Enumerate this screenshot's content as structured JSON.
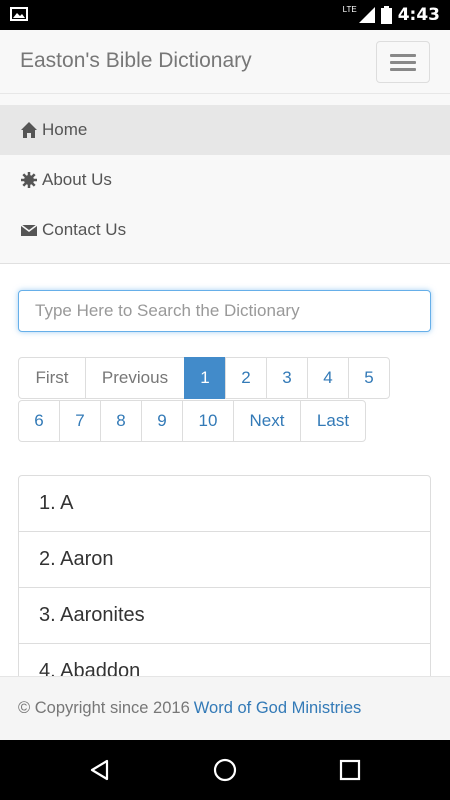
{
  "status_bar": {
    "network": "LTE",
    "time": "4:43"
  },
  "navbar": {
    "brand": "Easton's Bible Dictionary"
  },
  "menu": {
    "items": [
      {
        "label": "Home",
        "icon": "home-icon"
      },
      {
        "label": "About Us",
        "icon": "gear-icon"
      },
      {
        "label": "Contact Us",
        "icon": "envelope-icon"
      }
    ]
  },
  "search": {
    "placeholder": "Type Here to Search the Dictionary",
    "value": ""
  },
  "pagination": {
    "row1": [
      "First",
      "Previous",
      "1",
      "2",
      "3",
      "4",
      "5"
    ],
    "row2": [
      "6",
      "7",
      "8",
      "9",
      "10",
      "Next",
      "Last"
    ],
    "active": "1"
  },
  "entries": [
    "1. A",
    "2. Aaron",
    "3. Aaronites",
    "4. Abaddon"
  ],
  "footer": {
    "copyright": "© Copyright since 2016",
    "link": "Word of God Ministries"
  },
  "colors": {
    "accent": "#428bca",
    "link": "#337ab7",
    "navbar_bg": "#f8f8f8"
  }
}
